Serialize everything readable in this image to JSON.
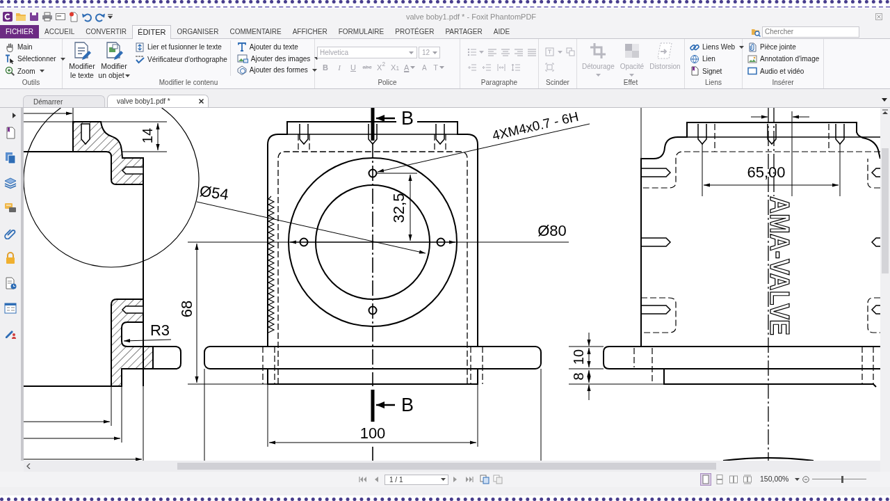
{
  "window": {
    "title": "valve boby1.pdf * - Foxit PhantomPDF"
  },
  "menu_tabs": [
    {
      "label": "FICHIER",
      "kind": "file",
      "selected": false
    },
    {
      "label": "ACCUEIL",
      "kind": "tab",
      "selected": false
    },
    {
      "label": "CONVERTIR",
      "kind": "tab",
      "selected": false
    },
    {
      "label": "ÉDITER",
      "kind": "tab",
      "selected": true
    },
    {
      "label": "ORGANISER",
      "kind": "tab",
      "selected": false
    },
    {
      "label": "COMMENTAIRE",
      "kind": "tab",
      "selected": false
    },
    {
      "label": "AFFICHER",
      "kind": "tab",
      "selected": false
    },
    {
      "label": "FORMULAIRE",
      "kind": "tab",
      "selected": false
    },
    {
      "label": "PROTÉGER",
      "kind": "tab",
      "selected": false
    },
    {
      "label": "PARTAGER",
      "kind": "tab",
      "selected": false
    },
    {
      "label": "AIDE",
      "kind": "tab",
      "selected": false
    }
  ],
  "search": {
    "placeholder": "Chercher"
  },
  "ribbon": [
    {
      "kind": "tools",
      "label": "Outils",
      "disabled": false,
      "columns": [
        {
          "kind": "small",
          "items": [
            {
              "label": "Main",
              "dropdown": false
            },
            {
              "label": "Sélectionner",
              "dropdown": true
            },
            {
              "label": "Zoom",
              "dropdown": true
            }
          ]
        }
      ]
    },
    {
      "kind": "content",
      "label": "Modifier le contenu",
      "disabled": false,
      "columns": [
        {
          "kind": "large",
          "items": [
            {
              "label": "Modifier le texte",
              "dropdown": false
            },
            {
              "label": "Modifier un objet",
              "dropdown": true
            }
          ]
        },
        {
          "kind": "small",
          "items": [
            {
              "label": "Lier et fusionner le texte",
              "dropdown": false
            },
            {
              "label": "Vérificateur d'orthographe",
              "dropdown": false
            }
          ]
        },
        {
          "kind": "small",
          "items": [
            {
              "label": "Ajouter du texte",
              "dropdown": false
            },
            {
              "label": "Ajouter des images",
              "dropdown": true
            },
            {
              "label": "Ajouter des formes",
              "dropdown": true
            }
          ]
        }
      ]
    },
    {
      "kind": "font",
      "label": "Police",
      "disabled": true,
      "font": "Helvetica",
      "size": "12",
      "buttons": [
        "B",
        "I",
        "U",
        "abc",
        "X$^{2}$",
        "X$_{1}$",
        "A",
        "A",
        "T"
      ]
    },
    {
      "kind": "paragraph",
      "label": "Paragraphe",
      "disabled": true
    },
    {
      "kind": "split",
      "label": "Scinder",
      "disabled": true
    },
    {
      "kind": "effect",
      "label": "Effet",
      "disabled": true,
      "columns": [
        {
          "kind": "large",
          "items": [
            {
              "label": "Détourage",
              "dropdown": true
            },
            {
              "label": "Opacité",
              "dropdown": true
            },
            {
              "label": "Distorsion",
              "dropdown": false
            }
          ]
        }
      ]
    },
    {
      "kind": "links",
      "label": "Liens",
      "disabled": false,
      "columns": [
        {
          "kind": "small",
          "items": [
            {
              "label": "Liens Web",
              "dropdown": true
            },
            {
              "label": "Lien",
              "dropdown": false
            },
            {
              "label": "Signet",
              "dropdown": false
            }
          ]
        }
      ]
    },
    {
      "kind": "insert",
      "label": "Insérer",
      "disabled": false,
      "columns": [
        {
          "kind": "small",
          "items": [
            {
              "label": "Pièce jointe",
              "dropdown": false
            },
            {
              "label": "Annotation d'image",
              "dropdown": false
            },
            {
              "label": "Audio et vidéo",
              "dropdown": false
            }
          ]
        }
      ]
    }
  ],
  "doc_tabs": [
    {
      "label": "Démarrer",
      "selected": false,
      "closable": false
    },
    {
      "label": "valve boby1.pdf *",
      "selected": true,
      "closable": true
    }
  ],
  "drawing": {
    "labels": [
      {
        "text": "B",
        "kind": "section"
      },
      {
        "text": "4XM4x0.7 - 6H",
        "kind": "note"
      },
      {
        "text": "14",
        "kind": "dimension"
      },
      {
        "text": "65,00",
        "kind": "dimension"
      },
      {
        "text": "Ø54",
        "kind": "dimension"
      },
      {
        "text": "AMA-VALVE",
        "kind": "engraving"
      },
      {
        "text": "32,5",
        "kind": "dimension"
      },
      {
        "text": "Ø80",
        "kind": "dimension"
      },
      {
        "text": "68",
        "kind": "dimension"
      },
      {
        "text": "R3",
        "kind": "dimension"
      },
      {
        "text": "10",
        "kind": "dimension"
      },
      {
        "text": "8",
        "kind": "dimension"
      },
      {
        "text": "B",
        "kind": "section"
      },
      {
        "text": "100",
        "kind": "dimension"
      }
    ]
  },
  "status_bar": {
    "page": "1 / 1",
    "view_modes": [
      {
        "selected": true
      },
      {
        "selected": false
      },
      {
        "selected": false
      },
      {
        "selected": false
      }
    ],
    "zoom": "150,00%",
    "zoom_slider": {
      "level": 0.55
    }
  }
}
